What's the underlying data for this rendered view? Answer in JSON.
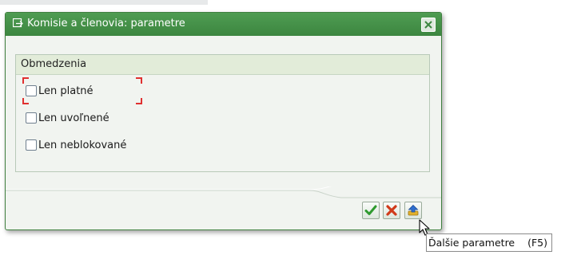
{
  "dialog": {
    "title": "Komisie a členovia: parametre",
    "close_icon": "close-icon"
  },
  "group": {
    "header": "Obmedzenia",
    "options": [
      {
        "label": "Len platné",
        "checked": false,
        "focused": true
      },
      {
        "label": "Len uvoľnené",
        "checked": false,
        "focused": false
      },
      {
        "label": "Len neblokované",
        "checked": false,
        "focused": false
      }
    ]
  },
  "buttons": {
    "ok_icon": "check-icon",
    "cancel_icon": "cancel-icon",
    "more_icon": "more-params-icon"
  },
  "tooltip": {
    "text": "Ďalšie parametre",
    "shortcut": "(F5)"
  },
  "colors": {
    "title_bar": "#3c8640",
    "focus_marker": "#e03030",
    "ok_icon": "#2f9a2f",
    "cancel_icon": "#d03a1a"
  }
}
